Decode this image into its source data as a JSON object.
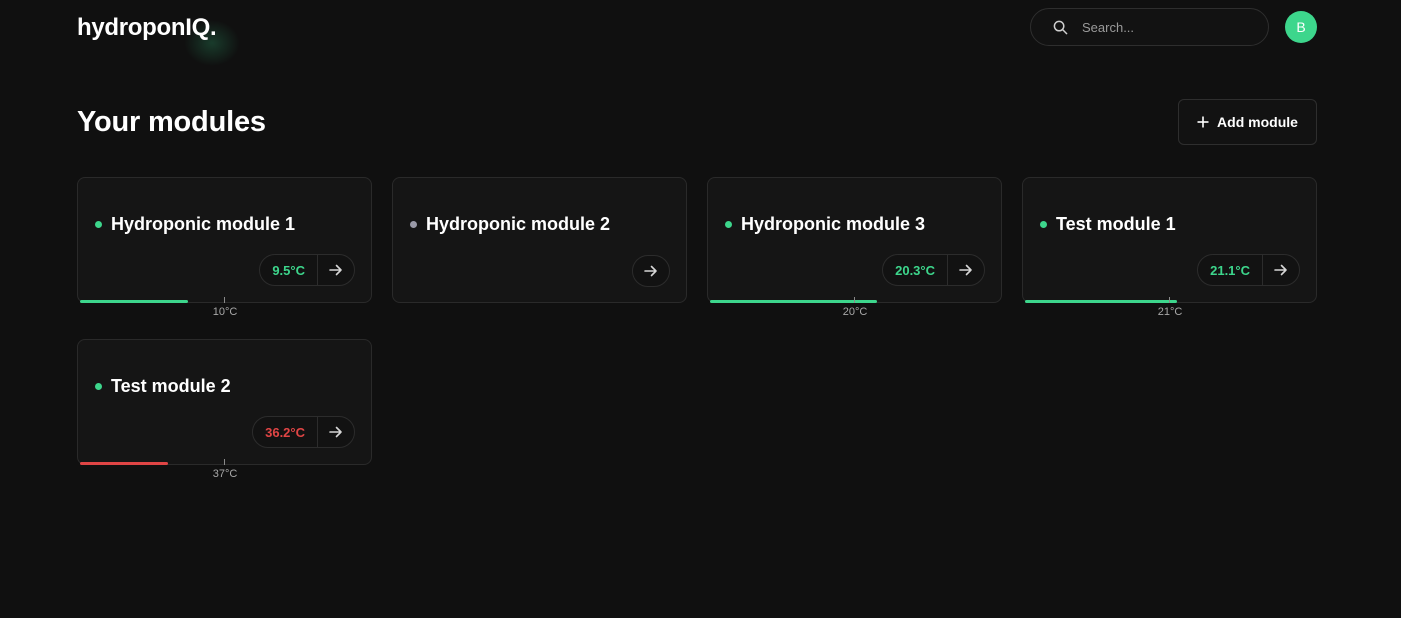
{
  "brand": {
    "name": "hydroponIQ."
  },
  "search": {
    "placeholder": "Search..."
  },
  "user": {
    "initial": "B"
  },
  "page": {
    "title": "Your modules",
    "add_button_label": "Add module"
  },
  "colors": {
    "accent": "#3dd68c",
    "alert": "#e04545",
    "offline": "#9a9aa8"
  },
  "modules": [
    {
      "name": "Hydroponic module 1",
      "status": "online",
      "temperature": "9.5°C",
      "temp_color": "#3dd68c",
      "target_label": "10°C",
      "level": 0.37,
      "bar_color": "#3dd68c"
    },
    {
      "name": "Hydroponic module 2",
      "status": "offline",
      "temperature": null,
      "temp_color": null,
      "target_label": null,
      "level": null,
      "bar_color": null
    },
    {
      "name": "Hydroponic module 3",
      "status": "online",
      "temperature": "20.3°C",
      "temp_color": "#3dd68c",
      "target_label": "20°C",
      "level": 0.57,
      "bar_color": "#3dd68c"
    },
    {
      "name": "Test module 1",
      "status": "online",
      "temperature": "21.1°C",
      "temp_color": "#3dd68c",
      "target_label": "21°C",
      "level": 0.52,
      "bar_color": "#3dd68c"
    },
    {
      "name": "Test module 2",
      "status": "online",
      "temperature": "36.2°C",
      "temp_color": "#e04545",
      "target_label": "37°C",
      "level": 0.3,
      "bar_color": "#e04545"
    }
  ]
}
